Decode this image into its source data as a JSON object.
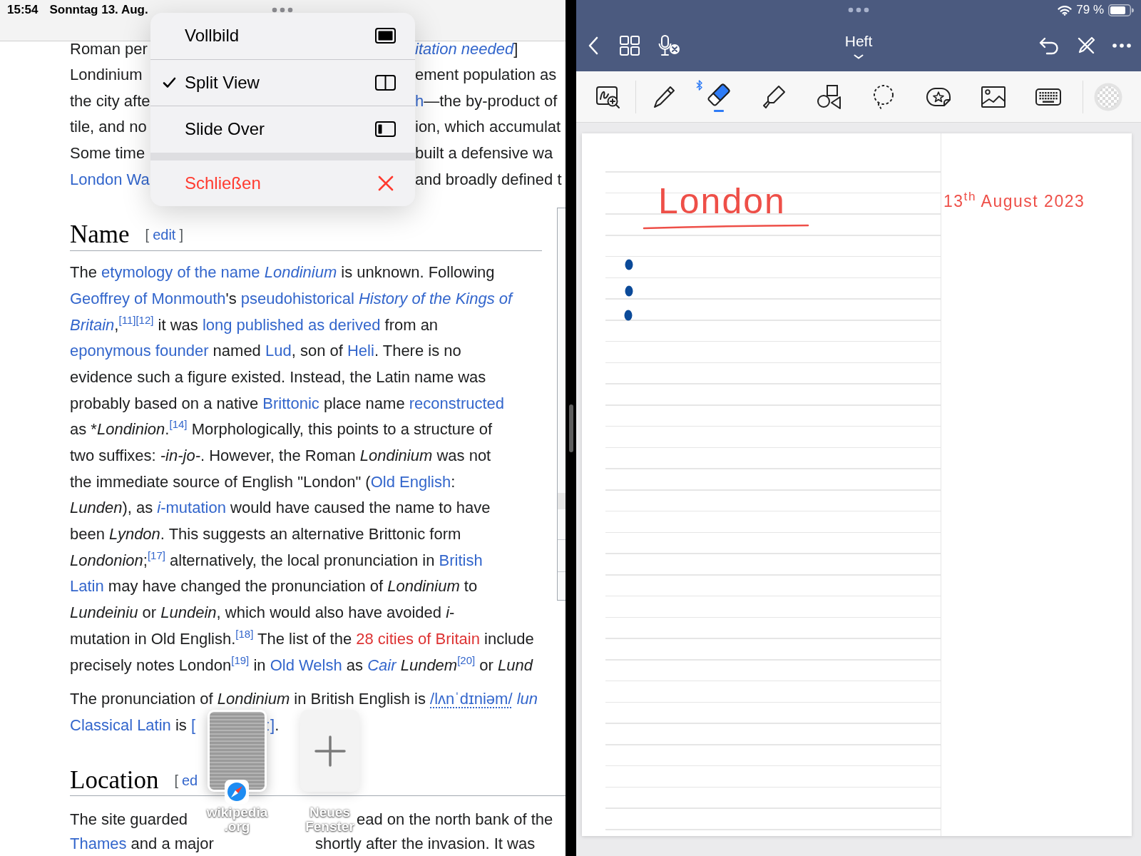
{
  "safari": {
    "status_bar": {
      "time": "15:54",
      "date": "Sonntag 13. Aug."
    },
    "intro_lines": [
      [
        [
          {
            "kind": "plain",
            "text": "Roman per"
          }
        ],
        [
          {
            "kind": "link",
            "text": "*itation needed*"
          },
          {
            "kind": "plain",
            "text": "]"
          }
        ]
      ],
      [
        [
          {
            "kind": "plain",
            "text": "Londinium"
          }
        ],
        [
          {
            "kind": "plain",
            "text": "ement population as"
          }
        ]
      ],
      [
        [
          {
            "kind": "plain",
            "text": "the city afte"
          }
        ],
        [
          {
            "kind": "link",
            "text": "h"
          },
          {
            "kind": "plain",
            "text": "—the by-product of"
          }
        ]
      ],
      [
        [
          {
            "kind": "plain",
            "text": "tile, and no"
          }
        ],
        [
          {
            "kind": "plain",
            "text": "ion, which accumulat"
          }
        ]
      ],
      [
        [
          {
            "kind": "plain",
            "text": "Some time"
          }
        ],
        [
          {
            "kind": "plain",
            "text": "built a defensive wa"
          }
        ]
      ],
      [
        [
          {
            "kind": "link",
            "text": "London Wa"
          }
        ],
        [
          {
            "kind": "plain",
            "text": "and broadly defined t"
          }
        ]
      ]
    ],
    "sections": [
      {
        "heading": "Name",
        "edit": {
          "open": "[",
          "label": "edit",
          "close": "]"
        },
        "paragraphs": [
          {
            "lines": [
              [
                [
                  {
                    "kind": "plain",
                    "text": "The "
                  },
                  {
                    "kind": "link",
                    "text": "etymology of the name *Londinium*"
                  },
                  {
                    "kind": "plain",
                    "text": " is unknown. Following"
                  }
                ]
              ],
              [
                [
                  {
                    "kind": "link",
                    "text": "Geoffrey of Monmouth"
                  },
                  {
                    "kind": "plain",
                    "text": "'s "
                  },
                  {
                    "kind": "link",
                    "text": "pseudohistorical"
                  },
                  {
                    "kind": "link",
                    "text": "*History of the Kings of*"
                  }
                ]
              ],
              [
                [
                  {
                    "kind": "link",
                    "text": "*Britain*"
                  },
                  {
                    "kind": "plain",
                    "text": ","
                  },
                  {
                    "kind": "ref",
                    "text": "[11]"
                  },
                  {
                    "kind": "ref",
                    "text": "[12]"
                  },
                  {
                    "kind": "plain",
                    "text": " it was "
                  },
                  {
                    "kind": "link",
                    "text": "long published as derived"
                  },
                  {
                    "kind": "plain",
                    "text": " from an"
                  }
                ]
              ],
              [
                [
                  {
                    "kind": "link",
                    "text": "eponymous founder"
                  },
                  {
                    "kind": "plain",
                    "text": " named "
                  },
                  {
                    "kind": "link",
                    "text": "Lud"
                  },
                  {
                    "kind": "plain",
                    "text": ", son of "
                  },
                  {
                    "kind": "link",
                    "text": "Heli"
                  },
                  {
                    "kind": "plain",
                    "text": ". There is no"
                  }
                ]
              ],
              [
                [
                  {
                    "kind": "plain",
                    "text": "evidence such a figure existed. Instead, the Latin name was"
                  }
                ]
              ],
              [
                [
                  {
                    "kind": "plain",
                    "text": "probably based on a native "
                  },
                  {
                    "kind": "link",
                    "text": "Brittonic"
                  },
                  {
                    "kind": "plain",
                    "text": " place name "
                  },
                  {
                    "kind": "link",
                    "text": "reconstructed"
                  }
                ]
              ],
              [
                [
                  {
                    "kind": "plain",
                    "text": "as *"
                  },
                  {
                    "kind": "plain",
                    "text": "*Londinion*."
                  },
                  {
                    "kind": "ref",
                    "text": "[14]"
                  },
                  {
                    "kind": "plain",
                    "text": " Morphologically, this points to a structure of"
                  }
                ]
              ],
              [
                [
                  {
                    "kind": "plain",
                    "text": "two suffixes: *-in-jo-*. However, the Roman *Londinium* was not"
                  }
                ]
              ],
              [
                [
                  {
                    "kind": "plain",
                    "text": "the immediate source of English \"London\" ("
                  },
                  {
                    "kind": "link",
                    "text": "Old English"
                  },
                  {
                    "kind": "plain",
                    "text": ":"
                  }
                ]
              ],
              [
                [
                  {
                    "kind": "plain",
                    "text": "*Lunden*), as "
                  },
                  {
                    "kind": "link",
                    "text": "*i*-mutation"
                  },
                  {
                    "kind": "plain",
                    "text": " would have caused the name to have"
                  }
                ]
              ],
              [
                [
                  {
                    "kind": "plain",
                    "text": "been *Lyndon*. This suggests an alternative Brittonic form"
                  }
                ]
              ],
              [
                [
                  {
                    "kind": "plain",
                    "text": "*Londonion*;"
                  },
                  {
                    "kind": "ref",
                    "text": "[17]"
                  },
                  {
                    "kind": "plain",
                    "text": " alternatively, the local pronunciation in "
                  },
                  {
                    "kind": "link",
                    "text": "British"
                  }
                ]
              ],
              [
                [
                  {
                    "kind": "link",
                    "text": "Latin"
                  },
                  {
                    "kind": "plain",
                    "text": " may have changed the pronunciation of *Londinium* to"
                  }
                ]
              ],
              [
                [
                  {
                    "kind": "plain",
                    "text": "*Lundeiniu* or *Lundein*, which would also have avoided *i*-"
                  }
                ]
              ],
              [
                [
                  {
                    "kind": "plain",
                    "text": "mutation in Old English."
                  },
                  {
                    "kind": "ref",
                    "text": "[18]"
                  },
                  {
                    "kind": "plain",
                    "text": " The list of the "
                  },
                  {
                    "kind": "missing_link",
                    "text": "28 cities of Britain"
                  },
                  {
                    "kind": "plain",
                    "text": " include"
                  }
                ]
              ],
              [
                [
                  {
                    "kind": "plain",
                    "text": "precisely notes London"
                  },
                  {
                    "kind": "ref",
                    "text": "[19]"
                  },
                  {
                    "kind": "plain",
                    "text": " in "
                  },
                  {
                    "kind": "link",
                    "text": "Old Welsh"
                  },
                  {
                    "kind": "plain",
                    "text": " as "
                  },
                  {
                    "kind": "link",
                    "text": "*Cair*"
                  },
                  {
                    "kind": "plain",
                    "text": " *Lundem*"
                  },
                  {
                    "kind": "ref",
                    "text": "[20]"
                  },
                  {
                    "kind": "plain",
                    "text": " or *Lund*"
                  }
                ]
              ]
            ]
          },
          {
            "lines": [
              [
                [
                  {
                    "kind": "plain",
                    "text": "The pronunciation of *Londinium* in British English is "
                  },
                  {
                    "kind": "ipa",
                    "text": "/lʌnˈdɪniəm/"
                  },
                  {
                    "kind": "link",
                    "text": "*lun*"
                  }
                ]
              ],
              [
                [
                  {
                    "kind": "link",
                    "text": "Classical Latin"
                  },
                  {
                    "kind": "plain",
                    "text": " is "
                  },
                  {
                    "kind": "link",
                    "text": "["
                  }
                ],
                [
                  {
                    "kind": "link",
                    "text": "ː]"
                  },
                  {
                    "kind": "plain",
                    "text": "."
                  }
                ]
              ]
            ]
          }
        ]
      },
      {
        "heading": "Location",
        "edit": {
          "open": "[",
          "label": "ed"
        },
        "paragraphs": [
          {
            "lines": [
              [
                [
                  {
                    "kind": "plain",
                    "text": "The site guarded"
                  }
                ],
                [
                  {
                    "kind": "plain",
                    "text": "ead on the north bank of the"
                  }
                ]
              ],
              [
                [
                  {
                    "kind": "link",
                    "text": "Thames"
                  },
                  {
                    "kind": "plain",
                    "text": " and a major"
                  }
                ],
                [
                  {
                    "kind": "plain",
                    "text": "shortly after the invasion. It was"
                  }
                ]
              ]
            ]
          }
        ]
      }
    ]
  },
  "window_menu": {
    "items": [
      {
        "kind": "fullscreen",
        "label": "Vollbild",
        "selected": false
      },
      {
        "kind": "split_view",
        "label": "Split View",
        "selected": true
      },
      {
        "kind": "slide_over",
        "label": "Slide Over",
        "selected": false
      },
      {
        "kind": "close",
        "label": "Schließen",
        "selected": false
      }
    ]
  },
  "app_shelf": {
    "windows": [
      {
        "kind": "window",
        "label_lines": [
          "wikipedia",
          ".org"
        ]
      },
      {
        "kind": "new_window",
        "label_lines": [
          "Neues",
          "Fenster"
        ]
      }
    ]
  },
  "notes_app": {
    "status_bar": {
      "battery": "79 %"
    },
    "title": "Heft",
    "tools": [
      {
        "kind": "zoom",
        "selected": false
      },
      {
        "kind": "pen",
        "selected": false
      },
      {
        "kind": "eraser",
        "selected": true
      },
      {
        "kind": "highlighter",
        "selected": false
      },
      {
        "kind": "shapes",
        "selected": false
      },
      {
        "kind": "lasso",
        "selected": false
      },
      {
        "kind": "sticker",
        "selected": false
      },
      {
        "kind": "image",
        "selected": false
      },
      {
        "kind": "keyboard",
        "selected": false
      }
    ],
    "note": {
      "title": "London",
      "date": "13$^{th}$ August 2023"
    }
  }
}
